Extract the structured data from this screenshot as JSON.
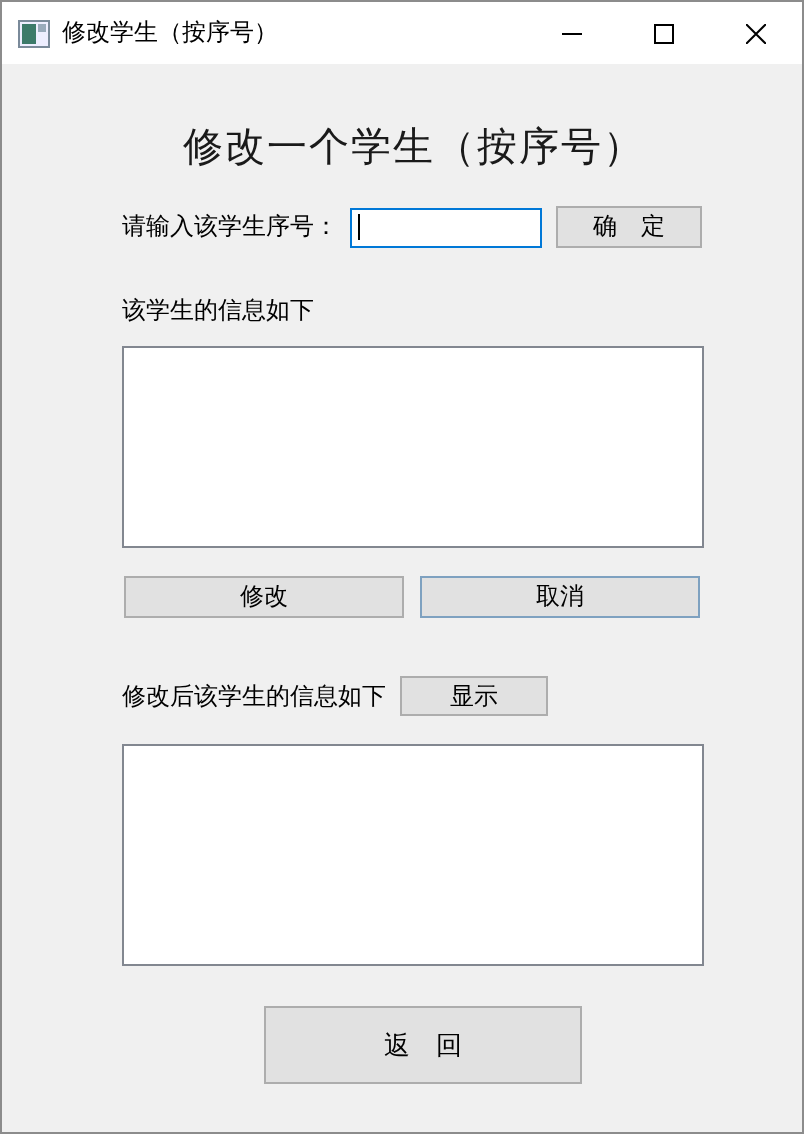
{
  "window": {
    "title": "修改学生（按序号）"
  },
  "heading": "修改一个学生（按序号）",
  "lookup": {
    "label": "请输入该学生序号：",
    "focused": true,
    "button": "确　定"
  },
  "info": {
    "label": "该学生的信息如下"
  },
  "actions": [
    {
      "label": "修改",
      "focused": false
    },
    {
      "label": "取消",
      "focused": true
    }
  ],
  "result": {
    "label": "修改后该学生的信息如下",
    "button": "显示"
  },
  "back_button": "返　回"
}
